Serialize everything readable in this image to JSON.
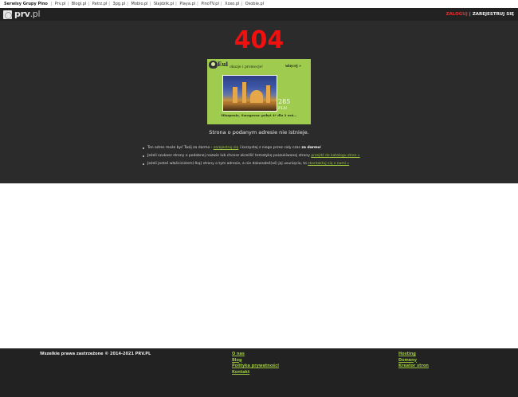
{
  "network_bar": {
    "lead": "Serwisy Grupy Pino",
    "links": [
      "Prv.pl",
      "Blogi.pl",
      "Patrz.pl",
      "3pg.pl",
      "Mobio.pl",
      "Slajdzik.pl",
      "Playa.pl",
      "PinoTV.pl",
      "Xoxo.pl",
      "Osobie.pl"
    ]
  },
  "header": {
    "logo_main": "prv",
    "logo_suffix": ".pl",
    "login": "ZALOGUJ",
    "separator": "|",
    "register": "ZAREJESTRUJ SIĘ"
  },
  "error": {
    "code": "404",
    "message": "Strona o podanym adresie nie istnieje."
  },
  "ad": {
    "brand": "Eul",
    "tagline": "okazje i promocje!",
    "more": "więcej »",
    "price": "285",
    "currency": "PLN",
    "description": "Hiszpania, Saragossa: pobyt 4* dla 2 osó..."
  },
  "tips": [
    {
      "before": "Ten adres może być Twój za darmo - ",
      "link": "zarejestruj się",
      "after": " i korzystaj z niego przez cały czas ",
      "bold": "za darmo",
      "tail": "!"
    },
    {
      "before": "Jeżeli szukasz strony o podobnej nazwie lub chcesz określić tematykę poszukiwanej strony ",
      "link": "przejdź do katalogu stron »",
      "after": "",
      "bold": "",
      "tail": ""
    },
    {
      "before": "Jeżeli jesteś właścicielem(-lką) strony o tym adresie, a nie dokonałeś(aś) jej usunięcia, to ",
      "link": "skontaktuj się z nami »",
      "after": "",
      "bold": "",
      "tail": ""
    }
  ],
  "footer": {
    "copyright": "Wszelkie prawa zastrzeżone © 2014-2021 PRV.PL",
    "col1": [
      "O nas",
      "Blog",
      "Polityka prywatności",
      "Kontakt"
    ],
    "col2": [
      "Hosting",
      "Domeny",
      "Kreator stron"
    ]
  },
  "colors": {
    "error_red": "#f01010",
    "link_green": "#9cc63d",
    "ad_green": "#9fcb4f",
    "login_red": "#e03030"
  }
}
